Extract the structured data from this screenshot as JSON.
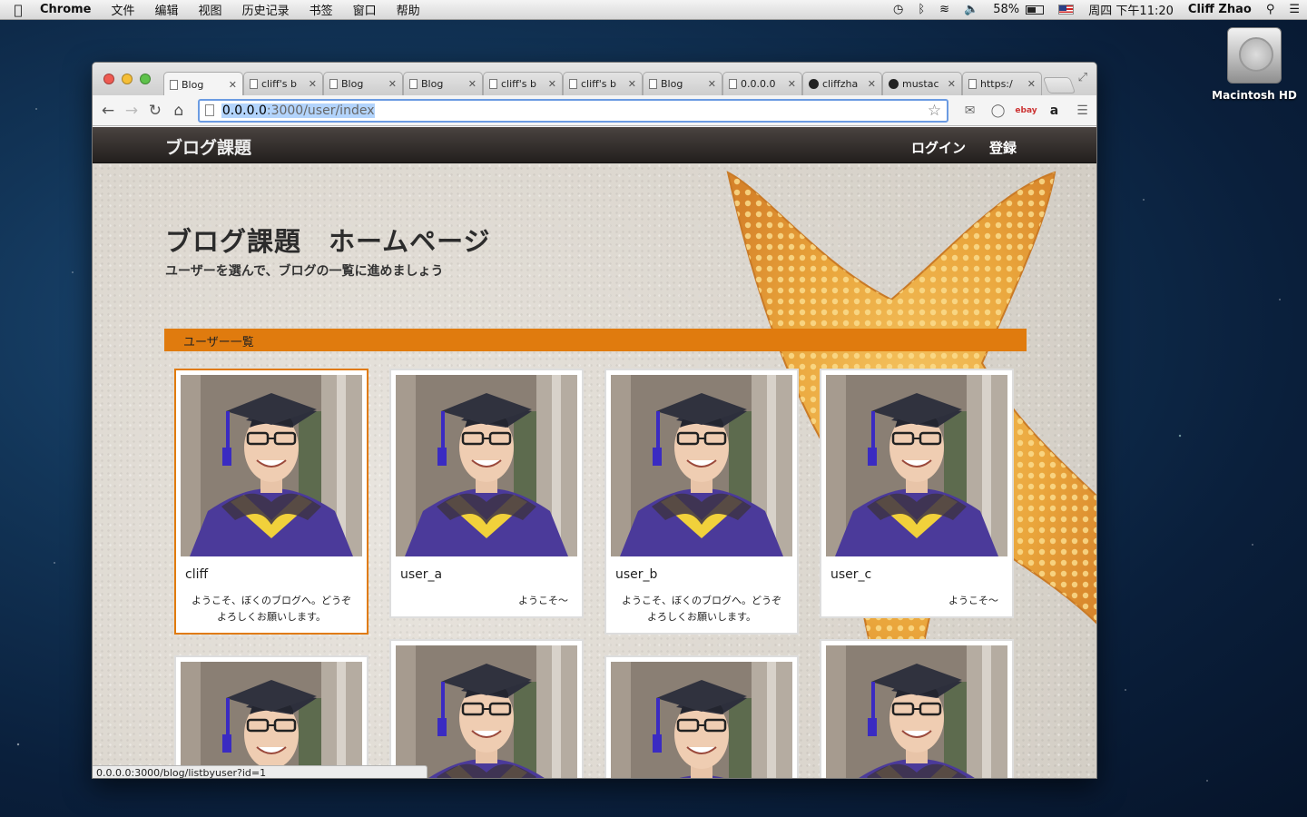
{
  "menubar": {
    "app": "Chrome",
    "items": [
      "文件",
      "编辑",
      "视图",
      "历史记录",
      "书签",
      "窗口",
      "帮助"
    ],
    "battery": "58%",
    "battery_level": 0.58,
    "clock": "周四 下午11:20",
    "user": "Cliff Zhao"
  },
  "desktop": {
    "hd_label": "Macintosh HD"
  },
  "browser": {
    "tabs": [
      {
        "title": "Blog",
        "active": true
      },
      {
        "title": "cliff's b",
        "active": false
      },
      {
        "title": "Blog",
        "active": false
      },
      {
        "title": "Blog",
        "active": false
      },
      {
        "title": "cliff's b",
        "active": false
      },
      {
        "title": "cliff's b",
        "active": false
      },
      {
        "title": "Blog",
        "active": false
      },
      {
        "title": "0.0.0.0",
        "active": false
      },
      {
        "title": "cliffzha",
        "active": false,
        "icon": "github"
      },
      {
        "title": "mustac",
        "active": false,
        "icon": "github"
      },
      {
        "title": "https:/",
        "active": false
      }
    ],
    "url_host": "0.0.0.0",
    "url_rest": ":3000/user/index",
    "status": "0.0.0.0:3000/blog/listbyuser?id=1"
  },
  "site": {
    "brand": "ブログ課題",
    "nav": {
      "login": "ログイン",
      "register": "登録"
    },
    "hero_title": "ブログ課題　ホームページ",
    "hero_sub": "ユーザーを選んで、ブログの一覧に進めましょう",
    "section_title": "ユーザー一覧",
    "users": [
      {
        "name": "cliff",
        "greeting": "ようこそ、ぼくのブログへ。どうぞよろしくお願いします。"
      },
      {
        "name": "user_a",
        "greeting": "ようこそ〜"
      },
      {
        "name": "user_b",
        "greeting": "ようこそ、ぼくのブログへ。どうぞよろしくお願いします。"
      },
      {
        "name": "user_c",
        "greeting": "ようこそ〜"
      }
    ]
  },
  "colors": {
    "accent": "#e07b0e",
    "nav_bg": "#2e2926"
  }
}
